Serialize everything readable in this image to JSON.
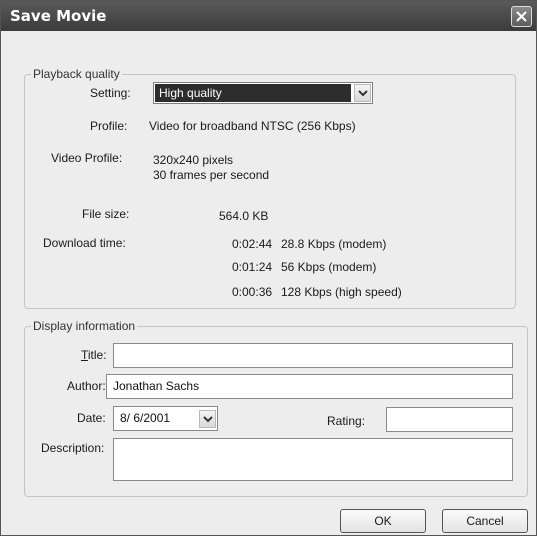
{
  "window": {
    "title": "Save Movie",
    "close_icon": "close-icon"
  },
  "playback": {
    "legend": "Playback quality",
    "setting_label": "Setting:",
    "setting_value": "High quality",
    "profile_label": "Profile:",
    "profile_value": "Video for broadband NTSC (256 Kbps)",
    "video_profile_label": "Video Profile:",
    "video_profile_lines": [
      "320x240 pixels",
      "30 frames per second"
    ],
    "file_size_label": "File size:",
    "file_size_value": "564.0 KB",
    "download_label": "Download time:",
    "downloads": [
      {
        "time": "0:02:44",
        "speed": "28.8 Kbps (modem)"
      },
      {
        "time": "0:01:24",
        "speed": "56 Kbps (modem)"
      },
      {
        "time": "0:00:36",
        "speed": "128 Kbps (high speed)"
      }
    ]
  },
  "display": {
    "legend": "Display information",
    "title_label": "Title:",
    "title_value": "",
    "author_label": "Author:",
    "author_value": "Jonathan Sachs",
    "date_label": "Date:",
    "date_value": "8/ 6/2001",
    "rating_label": "Rating:",
    "rating_value": "",
    "description_label": "Description:",
    "description_value": ""
  },
  "buttons": {
    "ok": "OK",
    "cancel": "Cancel"
  },
  "colors": {
    "titlebar": "#4a4a4a",
    "selection": "#2d2d2d",
    "dialog_bg": "#ededed"
  }
}
